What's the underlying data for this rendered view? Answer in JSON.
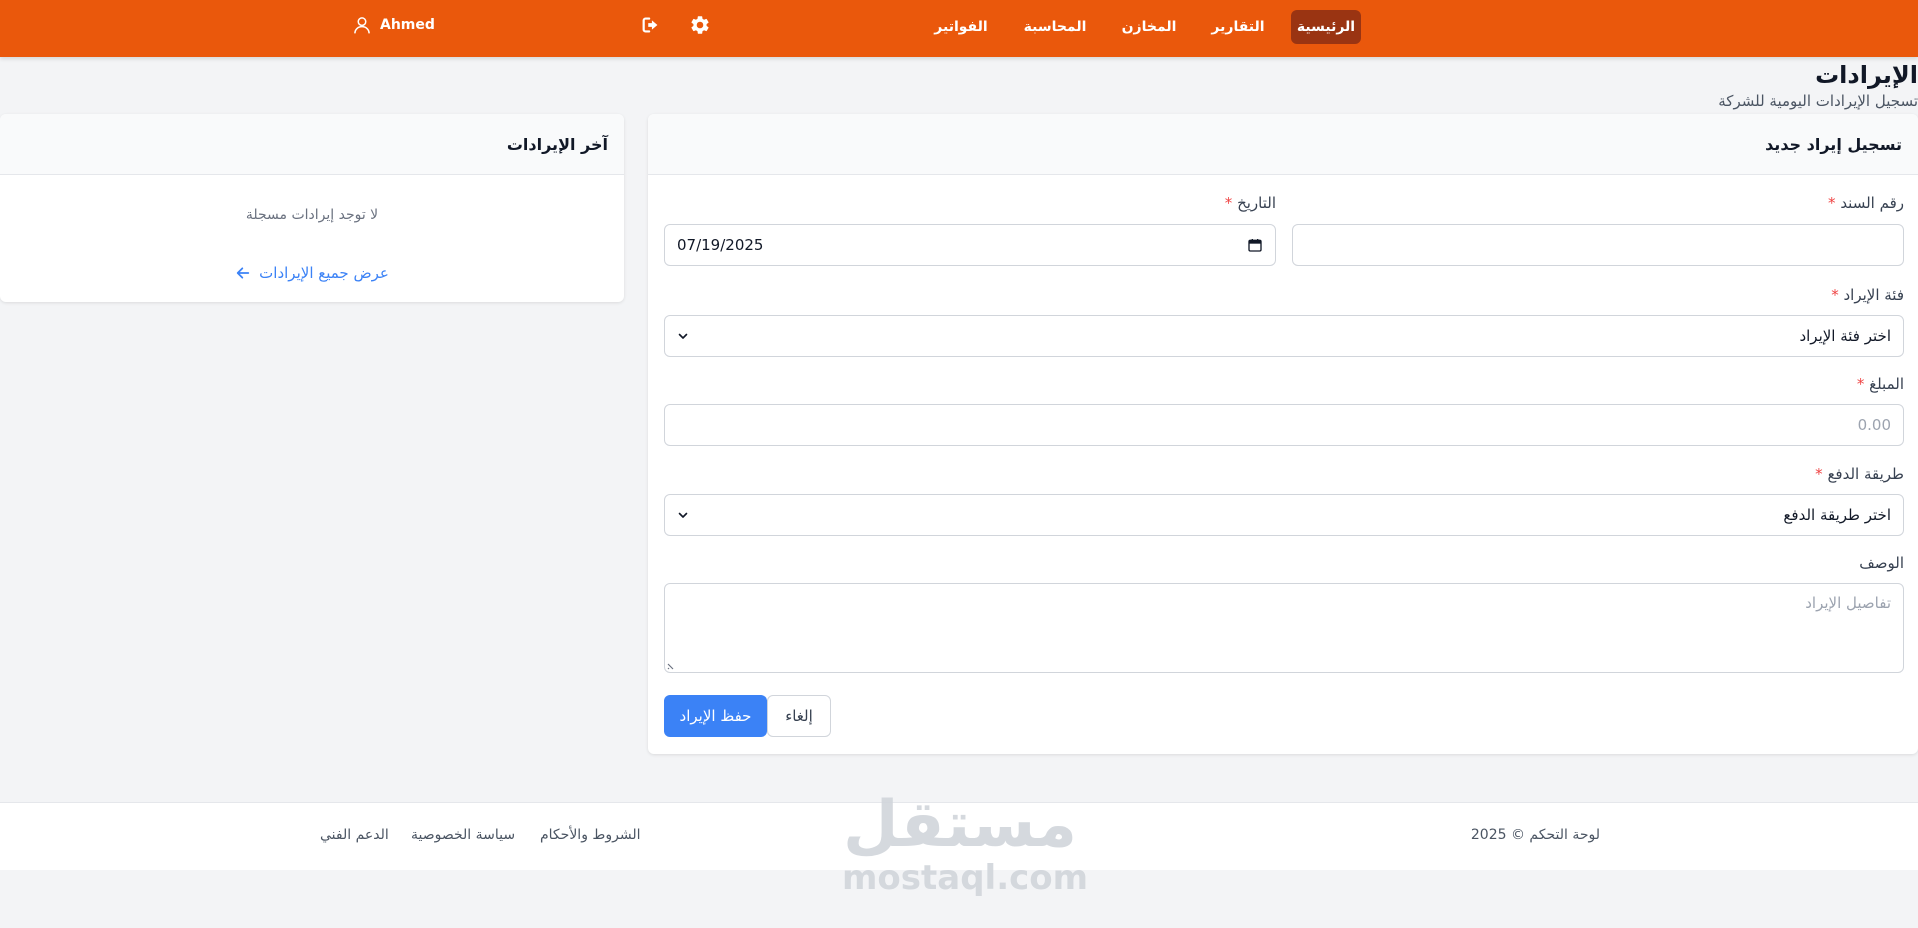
{
  "nav": {
    "items": [
      {
        "label": "الرئيسية",
        "active": true
      },
      {
        "label": "التقارير"
      },
      {
        "label": "المخازن"
      },
      {
        "label": "المحاسبة"
      },
      {
        "label": "الفواتير"
      }
    ],
    "user_name": "Ahmed",
    "icons": [
      "settings-icon",
      "logout-icon",
      "user-icon"
    ]
  },
  "page": {
    "title": "الإيرادات",
    "subtitle": "تسجيل الإيرادات اليومية للشركة"
  },
  "form": {
    "title": "تسجيل إيراد جديد",
    "voucher_label": "رقم السند",
    "voucher_value": "",
    "date_label": "التاريخ",
    "date_value": "07/19/2025",
    "category_label": "فئة الإيراد",
    "category_selected": "اختر فئة الإيراد",
    "amount_label": "المبلغ",
    "amount_placeholder": "0.00",
    "payment_label": "طريقة الدفع",
    "payment_selected": "اختر طريقة الدفع",
    "description_label": "الوصف",
    "description_placeholder": "تفاصيل الإيراد",
    "required_mark": "*",
    "save_label": "حفظ الإيراد",
    "cancel_label": "إلغاء"
  },
  "recent": {
    "title": "آخر الإيرادات",
    "empty_text": "لا توجد إيرادات مسجلة",
    "view_all_label": "عرض جميع الإيرادات"
  },
  "footer": {
    "copyright": "لوحة التحكم © 2025",
    "links": [
      "الشروط والأحكام",
      "سياسة الخصوصية",
      "الدعم الفني"
    ],
    "watermark_ar": "مستقل",
    "watermark_en": "mostaql.com"
  },
  "colors": {
    "navbar": "#ea580c",
    "nav_active": "#9a3412",
    "primary": "#3b82f6",
    "required": "#ef4444"
  }
}
